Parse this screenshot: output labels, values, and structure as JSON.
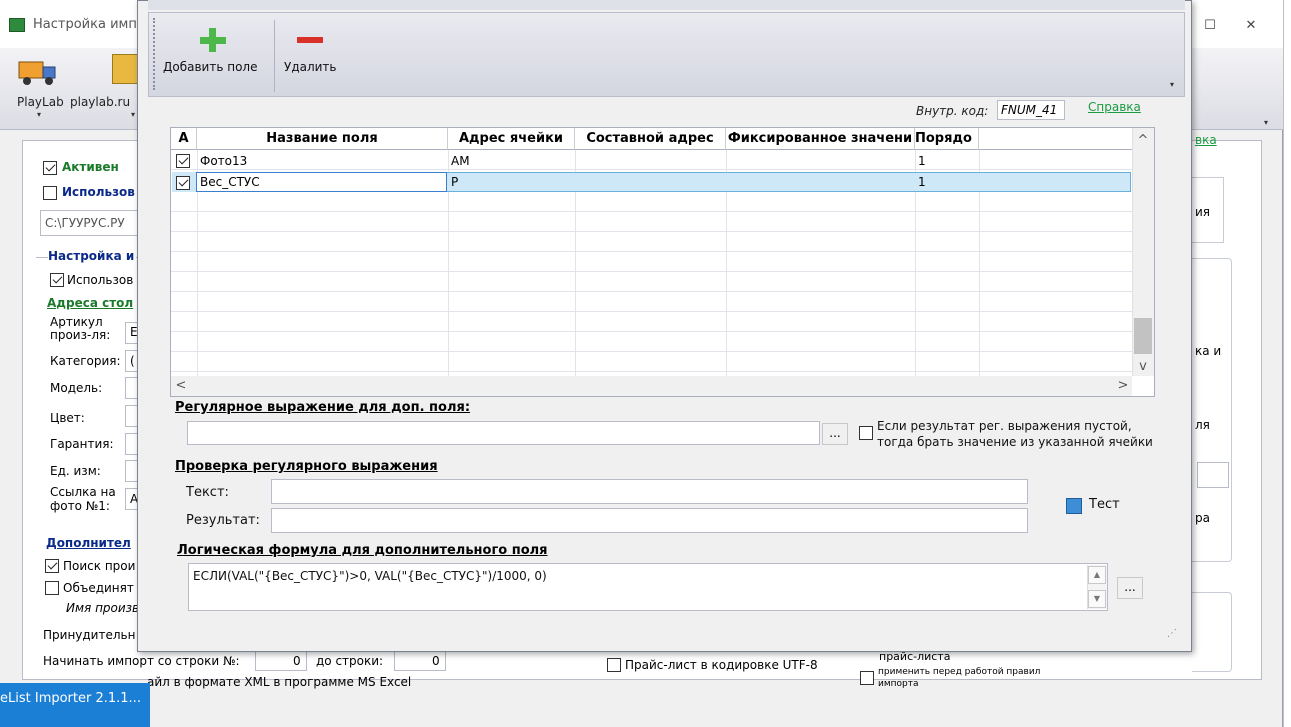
{
  "background_window": {
    "title": "Настройка имп",
    "window_controls": {
      "restore": "☐",
      "close": "✕"
    },
    "toolbar": [
      {
        "label": "PlayLab",
        "caret": "▾"
      },
      {
        "label": "playlab.ru",
        "caret": "▾"
      }
    ],
    "panel": {
      "active_label": "Активен",
      "use_label": "Использов",
      "path_value": "C:\\ГУУРУС.РУ",
      "settings_group": "Настройка и",
      "use_label_2": "Использов",
      "addresses_title": "Адреса стол",
      "fields": [
        {
          "label": "Артикул\nпроиз-ля:",
          "value": "E"
        },
        {
          "label": "Категория:",
          "value": "("
        },
        {
          "label": "Модель:",
          "value": ""
        },
        {
          "label": "Цвет:",
          "value": ""
        },
        {
          "label": "Гарантия:",
          "value": ""
        },
        {
          "label": "Ед. изм:",
          "value": ""
        },
        {
          "label": "Ссылка на\nфото №1:",
          "value": "A"
        }
      ],
      "additional_title": "Дополнител",
      "search_label": "Поиск прои",
      "merge_label": "Объединят",
      "product_name_italic": "Имя произв",
      "force_label": "Принудительн",
      "start_row_label": "Начинать импорт со строки №:",
      "start_row_value": "0",
      "to_row_label": "до строки:",
      "to_row_value": "0",
      "xml_label": "айл в формате XML в программе MS Excel",
      "utf8_label": "Прайс-лист в кодировке UTF-8",
      "right_texts": {
        "link_tail": "вка",
        "text_1": "ия",
        "text_2": "ка и",
        "text_3": "ля",
        "text_4": "ра",
        "text_5": "прайс-листа",
        "apply_label": "применить перед работой правил импорта"
      }
    }
  },
  "taskbar": {
    "label": "eList Importer 2.1.1...",
    "sub": ""
  },
  "dialog": {
    "toolbar": {
      "add_label": "Добавить поле",
      "delete_label": "Удалить",
      "overflow": "▾"
    },
    "internal_code_label": "Внутр. код:",
    "internal_code_value": "FNUM_41",
    "help_link": "Справка",
    "grid": {
      "headers": [
        "А",
        "Название поля",
        "Адрес ячейки",
        "Составной адрес",
        "Фиксированное значени",
        "Порядо"
      ],
      "rows": [
        {
          "checked": true,
          "name": "Фото13",
          "address": "AM",
          "composite": "",
          "fixed": "",
          "order": "1"
        },
        {
          "checked": true,
          "name": "Вес_СТУС",
          "address": "P",
          "composite": "",
          "fixed": "",
          "order": "1"
        }
      ],
      "scroll_up": "^",
      "scroll_down": "v",
      "scroll_left": "<",
      "scroll_right": ">"
    },
    "regex_section": {
      "title": "Регулярное выражение для доп. поля:",
      "value": "",
      "dots": "...",
      "empty_checkbox_label": "Если результат рег. выражения пустой,\nтогда брать значение из указанной ячейки"
    },
    "regex_check": {
      "title": "Проверка регулярного выражения",
      "text_label": "Текст:",
      "text_value": "",
      "result_label": "Результат:",
      "result_value": "",
      "test_button": "Тест"
    },
    "formula": {
      "title": "Логическая формула для дополнительного поля",
      "value": "ЕСЛИ(VAL(\"{Вес_СТУС}\")>0, VAL(\"{Вес_СТУС}\")/1000, 0)",
      "dots": "...",
      "resize_grip": "⋰"
    }
  }
}
